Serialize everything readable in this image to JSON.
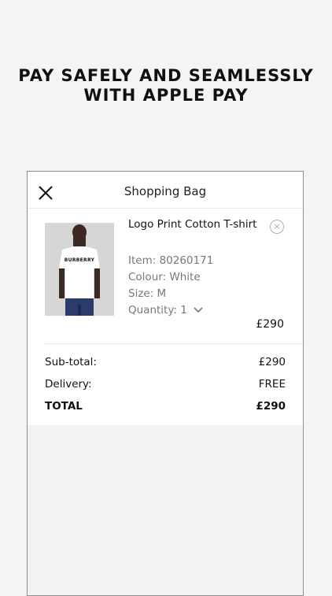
{
  "headline": {
    "line1": "PAY SAFELY AND SEAMLESSLY",
    "line2": "WITH APPLE PAY"
  },
  "bag": {
    "title": "Shopping Bag"
  },
  "item": {
    "name": "Logo Print Cotton T-shirt",
    "item_no": "Item: 80260171",
    "colour": "Colour: White",
    "size": "Size: M",
    "quantity": "Quantity: 1",
    "price": "£290",
    "tshirt_brand": "BURBERRY"
  },
  "summary": {
    "subtotal_label": "Sub-total:",
    "subtotal_value": "£290",
    "delivery_label": "Delivery:",
    "delivery_value": "FREE",
    "total_label": "TOTAL",
    "total_value": "£290"
  },
  "icons": {
    "close": "close-icon",
    "remove": "remove-circle-x-icon",
    "quantity": "chevron-down-icon"
  }
}
